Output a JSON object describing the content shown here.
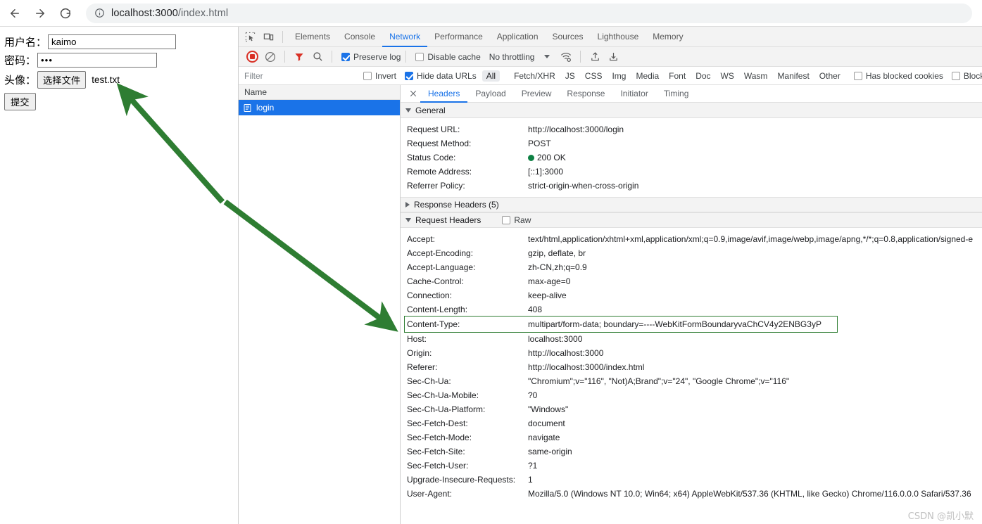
{
  "browser": {
    "back_label": "Back",
    "forward_label": "Forward",
    "reload_label": "Reload",
    "site_info_label": "View site information",
    "url_host": "localhost:3000",
    "url_path": "/index.html"
  },
  "page_form": {
    "username_label": "用户名：",
    "username_value": "kaimo",
    "password_label": "密码：",
    "password_value": "•••",
    "avatar_label": "头像：",
    "choose_file_button": "选择文件",
    "file_name": "test.txt",
    "submit_button": "提交"
  },
  "devtools": {
    "panel_tabs": [
      {
        "label": "Elements",
        "active": false
      },
      {
        "label": "Console",
        "active": false
      },
      {
        "label": "Network",
        "active": true
      },
      {
        "label": "Performance",
        "active": false
      },
      {
        "label": "Application",
        "active": false
      },
      {
        "label": "Sources",
        "active": false
      },
      {
        "label": "Lighthouse",
        "active": false
      },
      {
        "label": "Memory",
        "active": false
      }
    ],
    "toolbar": {
      "record_label": "Stop recording network log",
      "clear_label": "Clear network log",
      "filter_label": "Filter",
      "search_label": "Search",
      "preserve_log_label": "Preserve log",
      "preserve_log_checked": true,
      "disable_cache_label": "Disable cache",
      "disable_cache_checked": false,
      "throttling_value": "No throttling",
      "network_conditions_label": "Network conditions",
      "import_har_label": "Import HAR file",
      "export_har_label": "Export HAR file"
    },
    "filterbar": {
      "filter_placeholder": "Filter",
      "filter_value": "",
      "invert_label": "Invert",
      "invert_checked": false,
      "hide_data_urls_label": "Hide data URLs",
      "hide_data_urls_checked": true,
      "types": [
        "All",
        "Fetch/XHR",
        "JS",
        "CSS",
        "Img",
        "Media",
        "Font",
        "Doc",
        "WS",
        "Wasm",
        "Manifest",
        "Other"
      ],
      "active_type": "All",
      "has_blocked_cookies_label": "Has blocked cookies",
      "has_blocked_cookies_checked": false,
      "blocked_requests_label": "Blocked Requests",
      "blocked_requests_checked": false
    },
    "request_list": {
      "column_header": "Name",
      "rows": [
        {
          "name": "login",
          "selected": true
        }
      ]
    },
    "detail_tabs": [
      {
        "label": "Headers",
        "active": true
      },
      {
        "label": "Payload",
        "active": false
      },
      {
        "label": "Preview",
        "active": false
      },
      {
        "label": "Response",
        "active": false
      },
      {
        "label": "Initiator",
        "active": false
      },
      {
        "label": "Timing",
        "active": false
      }
    ],
    "general": {
      "section_title": "General",
      "expanded": true,
      "rows": [
        {
          "name": "Request URL:",
          "value": "http://localhost:3000/login"
        },
        {
          "name": "Request Method:",
          "value": "POST"
        },
        {
          "name": "Status Code:",
          "value": "200 OK",
          "status_dot": "#0d8043"
        },
        {
          "name": "Remote Address:",
          "value": "[::1]:3000"
        },
        {
          "name": "Referrer Policy:",
          "value": "strict-origin-when-cross-origin"
        }
      ]
    },
    "response_headers": {
      "section_title": "Response Headers (5)",
      "expanded": false
    },
    "request_headers": {
      "section_title": "Request Headers",
      "expanded": true,
      "raw_label": "Raw",
      "raw_checked": false,
      "rows": [
        {
          "name": "Accept:",
          "value": "text/html,application/xhtml+xml,application/xml;q=0.9,image/avif,image/webp,image/apng,*/*;q=0.8,application/signed-e"
        },
        {
          "name": "Accept-Encoding:",
          "value": "gzip, deflate, br"
        },
        {
          "name": "Accept-Language:",
          "value": "zh-CN,zh;q=0.9"
        },
        {
          "name": "Cache-Control:",
          "value": "max-age=0"
        },
        {
          "name": "Connection:",
          "value": "keep-alive"
        },
        {
          "name": "Content-Length:",
          "value": "408"
        },
        {
          "name": "Content-Type:",
          "value": "multipart/form-data; boundary=----WebKitFormBoundaryvaChCV4y2ENBG3yP",
          "highlight": true
        },
        {
          "name": "Host:",
          "value": "localhost:3000"
        },
        {
          "name": "Origin:",
          "value": "http://localhost:3000"
        },
        {
          "name": "Referer:",
          "value": "http://localhost:3000/index.html"
        },
        {
          "name": "Sec-Ch-Ua:",
          "value": "\"Chromium\";v=\"116\", \"Not)A;Brand\";v=\"24\", \"Google Chrome\";v=\"116\""
        },
        {
          "name": "Sec-Ch-Ua-Mobile:",
          "value": "?0"
        },
        {
          "name": "Sec-Ch-Ua-Platform:",
          "value": "\"Windows\""
        },
        {
          "name": "Sec-Fetch-Dest:",
          "value": "document"
        },
        {
          "name": "Sec-Fetch-Mode:",
          "value": "navigate"
        },
        {
          "name": "Sec-Fetch-Site:",
          "value": "same-origin"
        },
        {
          "name": "Sec-Fetch-User:",
          "value": "?1"
        },
        {
          "name": "Upgrade-Insecure-Requests:",
          "value": "1"
        },
        {
          "name": "User-Agent:",
          "value": "Mozilla/5.0 (Windows NT 10.0; Win64; x64) AppleWebKit/537.36 (KHTML, like Gecko) Chrome/116.0.0.0 Safari/537.36"
        }
      ]
    }
  },
  "annotations": {
    "arrow_color": "#2e7d32",
    "highlight_box_color": "#2e7d32"
  },
  "watermark": "CSDN @凯小默"
}
